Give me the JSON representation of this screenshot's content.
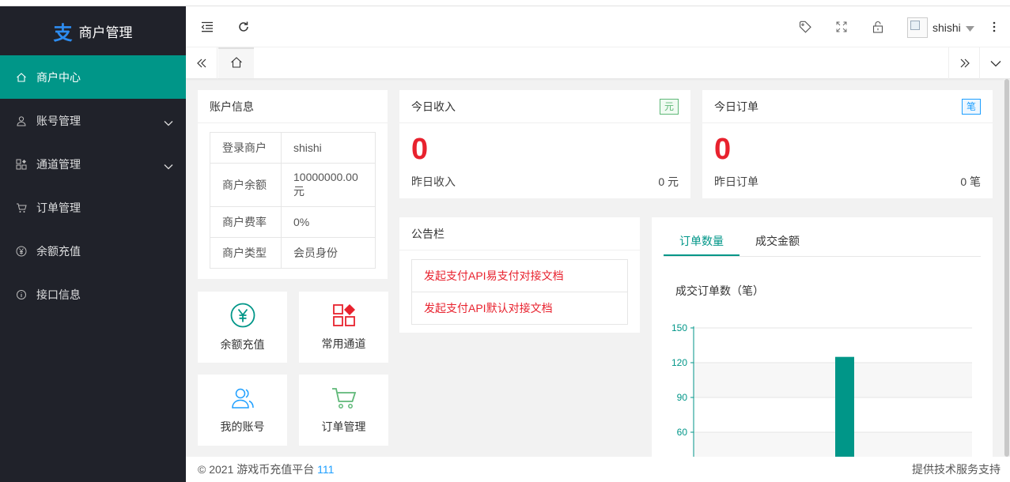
{
  "app": {
    "logo_glyph": "支",
    "title": "商户管理"
  },
  "sidebar": {
    "items": [
      {
        "label": "商户中心",
        "icon": "home-icon",
        "active": true
      },
      {
        "label": "账号管理",
        "icon": "user-icon",
        "has_children": true
      },
      {
        "label": "通道管理",
        "icon": "apps-icon",
        "has_children": true
      },
      {
        "label": "订单管理",
        "icon": "cart-icon"
      },
      {
        "label": "余额充值",
        "icon": "yen-icon"
      },
      {
        "label": "接口信息",
        "icon": "info-icon"
      }
    ]
  },
  "header": {
    "icons": [
      "menu-collapse-icon",
      "refresh-icon",
      "tag-icon",
      "fullscreen-icon",
      "lock-icon",
      "more-icon"
    ],
    "username": "shishi"
  },
  "account": {
    "title": "账户信息",
    "rows": [
      {
        "key": "登录商户",
        "value": "shishi"
      },
      {
        "key": "商户余额",
        "value": "10000000.00 元"
      },
      {
        "key": "商户费率",
        "value": "0%"
      },
      {
        "key": "商户类型",
        "value": "会员身份"
      }
    ]
  },
  "income": {
    "title": "今日收入",
    "badge": "元",
    "value": "0",
    "sub_label": "昨日收入",
    "sub_value": "0 元"
  },
  "orders": {
    "title": "今日订单",
    "badge": "笔",
    "value": "0",
    "sub_label": "昨日订单",
    "sub_value": "0 笔"
  },
  "quick": [
    {
      "label": "余额充值",
      "icon": "yen-circle-icon"
    },
    {
      "label": "常用通道",
      "icon": "channel-grid-icon"
    },
    {
      "label": "我的账号",
      "icon": "users-icon"
    },
    {
      "label": "订单管理",
      "icon": "cart-icon"
    }
  ],
  "notice": {
    "title": "公告栏",
    "links": [
      "发起支付API易支付对接文档",
      "发起支付API默认对接文档"
    ]
  },
  "chart_tabs": [
    "订单数量",
    "成交金额"
  ],
  "chart_data": {
    "type": "bar",
    "title": "成交订单数（笔）",
    "yticks": [
      150,
      120,
      90,
      60
    ],
    "visible_ylim": [
      60,
      150
    ],
    "series": [
      {
        "values": [
          125
        ]
      }
    ],
    "bar_color": "#009688"
  },
  "footer": {
    "copyright": "© 2021 游戏币充值平台",
    "version": "111",
    "right": "提供技术服务支持"
  },
  "colors": {
    "accent": "#009688",
    "sidebar": "#20222a",
    "red": "#e8222e"
  }
}
